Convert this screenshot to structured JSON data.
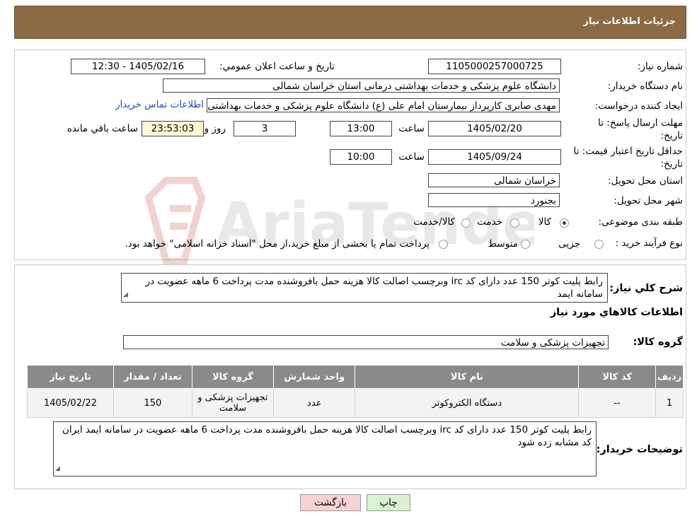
{
  "header": {
    "title": "جزئیات اطلاعات نیاز"
  },
  "form": {
    "need_number_label": "شماره نیاز:",
    "need_number": "1105000257000725",
    "announce_label": "تاریخ و ساعت اعلان عمومي:",
    "announce_value": "1405/02/16 - 12:30",
    "buyer_org_label": "نام دستگاه خريدار:",
    "buyer_org": "دانشگاه علوم پزشکی و خدمات بهداشتی درمانی استان خراسان شمالی",
    "requester_label": "ايجاد کننده درخواست:",
    "requester": "مهدی صابری کارپرداز بیمارستان امام علی (ع) دانشگاه علوم پزشکی و خدمات بهداشتی",
    "contact_link": "اطلاعات تماس خريدار",
    "deadline_label_1": "مهلت ارسال پاسخ: تا",
    "deadline_label_2": "تاريخ:",
    "deadline_date": "1405/02/20",
    "time_label": "ساعت",
    "deadline_time": "13:00",
    "days_value": "3",
    "days_label": "روز و",
    "remaining_time": "23:53:03",
    "remaining_label": "ساعت باقي مانده",
    "validity_label_1": "حداقل تاريخ اعتبار قيمت: تا",
    "validity_label_2": "تاريخ:",
    "validity_date": "1405/09/24",
    "validity_time": "10:00",
    "province_label": "استان محل تحويل:",
    "province": "خراسان شمالی",
    "city_label": "شهر محل تحويل:",
    "city": "بجنورد",
    "category_label": "طبقه بندی موضوعی:",
    "category_options": [
      "کالا",
      "خدمت",
      "کالا/خدمت"
    ],
    "category_selected": "کالا",
    "process_label": "نوع فرآیند خرید :",
    "process_options": [
      "جزیی",
      "متوسط"
    ],
    "process_note": "پرداخت تمام یا بخشی از مبلغ خرید،از محل \"اسناد خزانه اسلامی\" خواهد بود."
  },
  "summary": {
    "general_desc_label": "شرح کلي نياز:",
    "general_desc": "رابط پلیت کوتر 150 عدد دارای کد irc وبرچسب اصالت کالا هزینه حمل بافروشنده مدت پرداخت 6 ماهه عضویت در سامانه ایمد",
    "items_info_title": "اطلاعات کالاهاي مورد نياز",
    "goods_group_label": "گروه کالا:",
    "goods_group": "تجهیزات پزشکی و سلامت"
  },
  "table": {
    "headers": [
      "رديف",
      "کد کالا",
      "نام کالا",
      "واحد شمارش",
      "گروه کالا",
      "تعداد / مقدار",
      "تاريخ نياز"
    ],
    "rows": [
      [
        "1",
        "--",
        "دستگاه الکتروکوتر",
        "عدد",
        "تجهیزات پزشکی و سلامت",
        "150",
        "1405/02/22"
      ]
    ]
  },
  "buyer_notes": {
    "label": "توضيحات خريدار:",
    "text": "رابط پلیت کوتر 150 عدد دارای کد irc وبرچسب اصالت کالا هزینه حمل بافروشنده مدت پرداخت 6 ماهه عضویت در سامانه ایمد ایران کد مشابه زده شود"
  },
  "buttons": {
    "print": "چاپ",
    "back": "بازگشت"
  },
  "watermark": {
    "brand": "AriaTender.neT"
  },
  "colors": {
    "header_bg": "#8b6a44",
    "table_header_bg": "#8a8a8a",
    "back_button_bg": "#f9d3d3",
    "print_button_bg": "#d9f2d0",
    "timer_bg": "#fff9d6",
    "link": "#1a4fd6"
  }
}
